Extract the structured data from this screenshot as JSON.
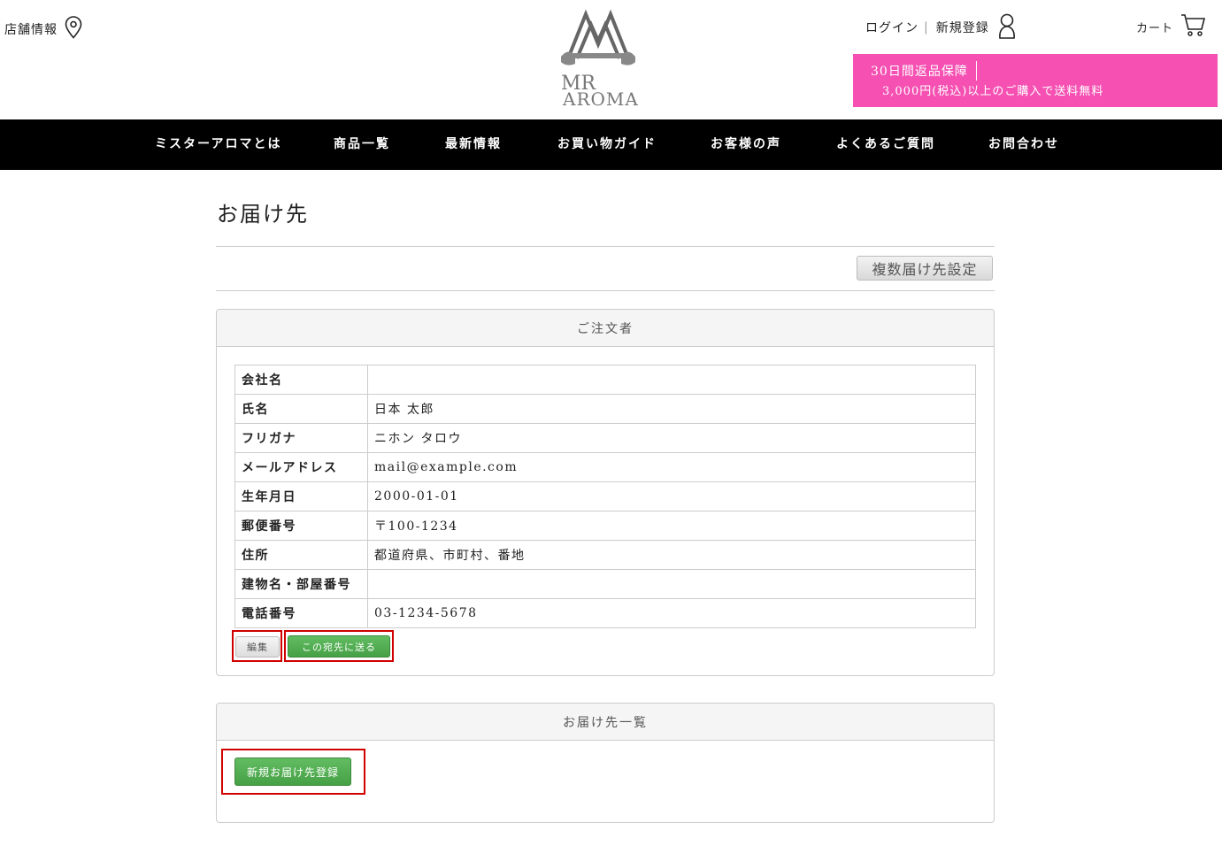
{
  "header": {
    "store_info": "店舗情報",
    "logo_text": [
      "MR",
      "AROMA"
    ],
    "login": "ログイン",
    "register": "新規登録",
    "cart": "カート",
    "promo": {
      "line1": "30日間返品保障",
      "line2": "3,000円(税込)以上のご購入で送料無料",
      "bg_color": "#f550b2"
    }
  },
  "nav": {
    "items": [
      "ミスターアロマとは",
      "商品一覧",
      "最新情報",
      "お買い物ガイド",
      "お客様の声",
      "よくあるご質問",
      "お問合わせ"
    ]
  },
  "main": {
    "title": "お届け先",
    "multi_button": "複数届け先設定",
    "orderer": {
      "heading": "ご注文者",
      "rows": [
        {
          "label": "会社名",
          "value": ""
        },
        {
          "label": "氏名",
          "value": "日本 太郎"
        },
        {
          "label": "フリガナ",
          "value": "ニホン タロウ"
        },
        {
          "label": "メールアドレス",
          "value": "mail@example.com"
        },
        {
          "label": "生年月日",
          "value": "2000-01-01"
        },
        {
          "label": "郵便番号",
          "value": "〒100-1234"
        },
        {
          "label": "住所",
          "value": "都道府県、市町村、番地"
        },
        {
          "label": "建物名・部屋番号",
          "value": ""
        },
        {
          "label": "電話番号",
          "value": "03-1234-5678"
        }
      ],
      "edit_button": "編集",
      "send_button": "この宛先に送る"
    },
    "addresses": {
      "heading": "お届け先一覧",
      "new_button": "新規お届け先登録"
    }
  },
  "colors": {
    "nav_bg": "#000000",
    "green_button": "#4cae4c",
    "highlight": "#d00000"
  }
}
